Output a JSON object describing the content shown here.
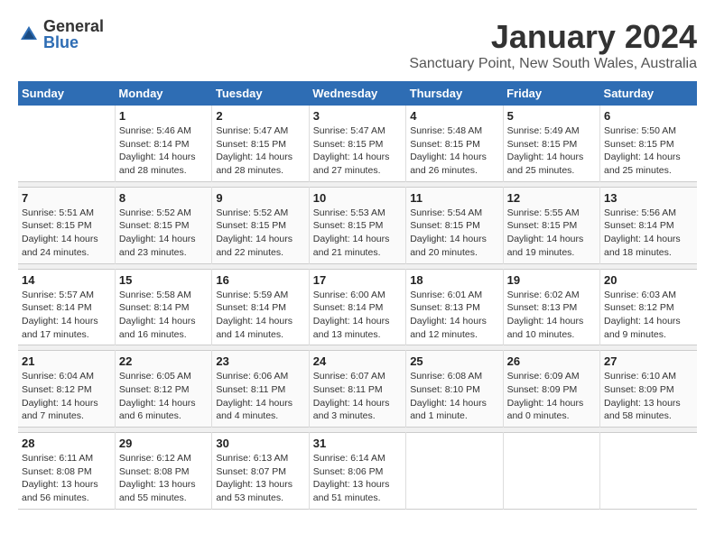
{
  "logo": {
    "text1": "General",
    "text2": "Blue"
  },
  "title": "January 2024",
  "subtitle": "Sanctuary Point, New South Wales, Australia",
  "headers": [
    "Sunday",
    "Monday",
    "Tuesday",
    "Wednesday",
    "Thursday",
    "Friday",
    "Saturday"
  ],
  "weeks": [
    {
      "days": [
        {
          "num": "",
          "info": ""
        },
        {
          "num": "1",
          "info": "Sunrise: 5:46 AM\nSunset: 8:14 PM\nDaylight: 14 hours\nand 28 minutes."
        },
        {
          "num": "2",
          "info": "Sunrise: 5:47 AM\nSunset: 8:15 PM\nDaylight: 14 hours\nand 28 minutes."
        },
        {
          "num": "3",
          "info": "Sunrise: 5:47 AM\nSunset: 8:15 PM\nDaylight: 14 hours\nand 27 minutes."
        },
        {
          "num": "4",
          "info": "Sunrise: 5:48 AM\nSunset: 8:15 PM\nDaylight: 14 hours\nand 26 minutes."
        },
        {
          "num": "5",
          "info": "Sunrise: 5:49 AM\nSunset: 8:15 PM\nDaylight: 14 hours\nand 25 minutes."
        },
        {
          "num": "6",
          "info": "Sunrise: 5:50 AM\nSunset: 8:15 PM\nDaylight: 14 hours\nand 25 minutes."
        }
      ]
    },
    {
      "days": [
        {
          "num": "7",
          "info": "Sunrise: 5:51 AM\nSunset: 8:15 PM\nDaylight: 14 hours\nand 24 minutes."
        },
        {
          "num": "8",
          "info": "Sunrise: 5:52 AM\nSunset: 8:15 PM\nDaylight: 14 hours\nand 23 minutes."
        },
        {
          "num": "9",
          "info": "Sunrise: 5:52 AM\nSunset: 8:15 PM\nDaylight: 14 hours\nand 22 minutes."
        },
        {
          "num": "10",
          "info": "Sunrise: 5:53 AM\nSunset: 8:15 PM\nDaylight: 14 hours\nand 21 minutes."
        },
        {
          "num": "11",
          "info": "Sunrise: 5:54 AM\nSunset: 8:15 PM\nDaylight: 14 hours\nand 20 minutes."
        },
        {
          "num": "12",
          "info": "Sunrise: 5:55 AM\nSunset: 8:15 PM\nDaylight: 14 hours\nand 19 minutes."
        },
        {
          "num": "13",
          "info": "Sunrise: 5:56 AM\nSunset: 8:14 PM\nDaylight: 14 hours\nand 18 minutes."
        }
      ]
    },
    {
      "days": [
        {
          "num": "14",
          "info": "Sunrise: 5:57 AM\nSunset: 8:14 PM\nDaylight: 14 hours\nand 17 minutes."
        },
        {
          "num": "15",
          "info": "Sunrise: 5:58 AM\nSunset: 8:14 PM\nDaylight: 14 hours\nand 16 minutes."
        },
        {
          "num": "16",
          "info": "Sunrise: 5:59 AM\nSunset: 8:14 PM\nDaylight: 14 hours\nand 14 minutes."
        },
        {
          "num": "17",
          "info": "Sunrise: 6:00 AM\nSunset: 8:14 PM\nDaylight: 14 hours\nand 13 minutes."
        },
        {
          "num": "18",
          "info": "Sunrise: 6:01 AM\nSunset: 8:13 PM\nDaylight: 14 hours\nand 12 minutes."
        },
        {
          "num": "19",
          "info": "Sunrise: 6:02 AM\nSunset: 8:13 PM\nDaylight: 14 hours\nand 10 minutes."
        },
        {
          "num": "20",
          "info": "Sunrise: 6:03 AM\nSunset: 8:12 PM\nDaylight: 14 hours\nand 9 minutes."
        }
      ]
    },
    {
      "days": [
        {
          "num": "21",
          "info": "Sunrise: 6:04 AM\nSunset: 8:12 PM\nDaylight: 14 hours\nand 7 minutes."
        },
        {
          "num": "22",
          "info": "Sunrise: 6:05 AM\nSunset: 8:12 PM\nDaylight: 14 hours\nand 6 minutes."
        },
        {
          "num": "23",
          "info": "Sunrise: 6:06 AM\nSunset: 8:11 PM\nDaylight: 14 hours\nand 4 minutes."
        },
        {
          "num": "24",
          "info": "Sunrise: 6:07 AM\nSunset: 8:11 PM\nDaylight: 14 hours\nand 3 minutes."
        },
        {
          "num": "25",
          "info": "Sunrise: 6:08 AM\nSunset: 8:10 PM\nDaylight: 14 hours\nand 1 minute."
        },
        {
          "num": "26",
          "info": "Sunrise: 6:09 AM\nSunset: 8:09 PM\nDaylight: 14 hours\nand 0 minutes."
        },
        {
          "num": "27",
          "info": "Sunrise: 6:10 AM\nSunset: 8:09 PM\nDaylight: 13 hours\nand 58 minutes."
        }
      ]
    },
    {
      "days": [
        {
          "num": "28",
          "info": "Sunrise: 6:11 AM\nSunset: 8:08 PM\nDaylight: 13 hours\nand 56 minutes."
        },
        {
          "num": "29",
          "info": "Sunrise: 6:12 AM\nSunset: 8:08 PM\nDaylight: 13 hours\nand 55 minutes."
        },
        {
          "num": "30",
          "info": "Sunrise: 6:13 AM\nSunset: 8:07 PM\nDaylight: 13 hours\nand 53 minutes."
        },
        {
          "num": "31",
          "info": "Sunrise: 6:14 AM\nSunset: 8:06 PM\nDaylight: 13 hours\nand 51 minutes."
        },
        {
          "num": "",
          "info": ""
        },
        {
          "num": "",
          "info": ""
        },
        {
          "num": "",
          "info": ""
        }
      ]
    }
  ]
}
